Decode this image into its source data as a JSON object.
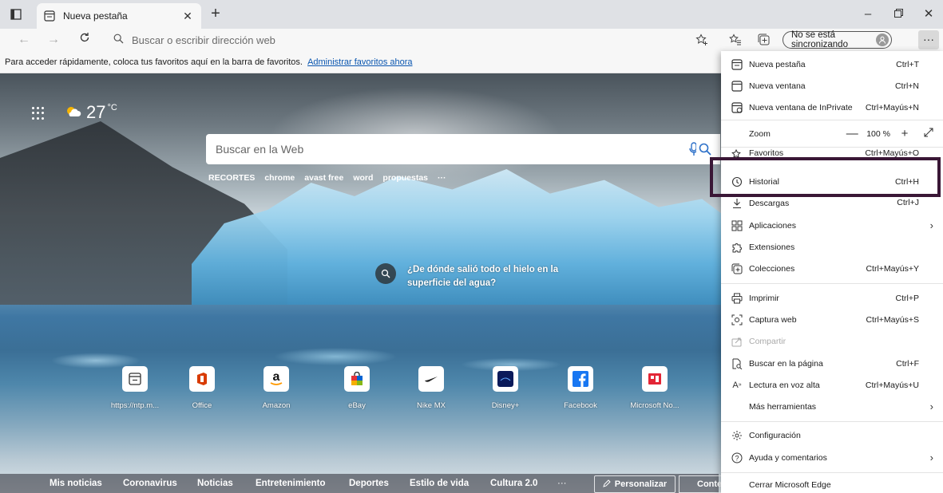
{
  "tab": {
    "title": "Nueva pestaña"
  },
  "address": {
    "placeholder": "Buscar o escribir dirección web"
  },
  "sync": {
    "label": "No se está sincronizando"
  },
  "favbar": {
    "text": "Para acceder rápidamente, coloca tus favoritos aquí en la barra de favoritos.",
    "link": "Administrar favoritos ahora"
  },
  "weather": {
    "temp": "27",
    "unit": "°C"
  },
  "search": {
    "placeholder": "Buscar en la Web",
    "links": [
      "RECORTES",
      "chrome",
      "avast free",
      "word",
      "propuestas",
      "···"
    ]
  },
  "caption": {
    "text": "¿De dónde salió todo el hielo en la superficie del agua?"
  },
  "tiles": [
    {
      "label": "https://ntp.m...",
      "icon": "page-icon"
    },
    {
      "label": "Office",
      "icon": "office-icon"
    },
    {
      "label": "Amazon",
      "icon": "amazon-icon"
    },
    {
      "label": "eBay",
      "icon": "ebay-icon"
    },
    {
      "label": "Nike MX",
      "icon": "nike-icon"
    },
    {
      "label": "Disney+",
      "icon": "disney-icon"
    },
    {
      "label": "Facebook",
      "icon": "facebook-icon"
    },
    {
      "label": "Microsoft No...",
      "icon": "msn-icon"
    }
  ],
  "news": {
    "items": [
      "Mis noticias",
      "Coronavirus",
      "Noticias",
      "Entretenimiento",
      "Deportes",
      "Estilo de vida",
      "Cultura 2.0",
      "···"
    ],
    "personalize": "Personalizar",
    "content": "Conten"
  },
  "menu": {
    "items": [
      {
        "label": "Nueva pestaña",
        "shortcut": "Ctrl+T"
      },
      {
        "label": "Nueva ventana",
        "shortcut": "Ctrl+N"
      },
      {
        "label": "Nueva ventana de InPrivate",
        "shortcut": "Ctrl+Mayús+N"
      },
      {
        "label": "Zoom",
        "zoom": "100 %"
      },
      {
        "label": "Favoritos",
        "shortcut": "Ctrl+Mayús+O"
      },
      {
        "label": "Historial",
        "shortcut": "Ctrl+H"
      },
      {
        "label": "Descargas",
        "shortcut": "Ctrl+J"
      },
      {
        "label": "Aplicaciones"
      },
      {
        "label": "Extensiones"
      },
      {
        "label": "Colecciones",
        "shortcut": "Ctrl+Mayús+Y"
      },
      {
        "label": "Imprimir",
        "shortcut": "Ctrl+P"
      },
      {
        "label": "Captura web",
        "shortcut": "Ctrl+Mayús+S"
      },
      {
        "label": "Compartir"
      },
      {
        "label": "Buscar en la página",
        "shortcut": "Ctrl+F"
      },
      {
        "label": "Lectura en voz alta",
        "shortcut": "Ctrl+Mayús+U"
      },
      {
        "label": "Más herramientas"
      },
      {
        "label": "Configuración"
      },
      {
        "label": "Ayuda y comentarios"
      },
      {
        "label": "Cerrar Microsoft Edge"
      }
    ]
  }
}
